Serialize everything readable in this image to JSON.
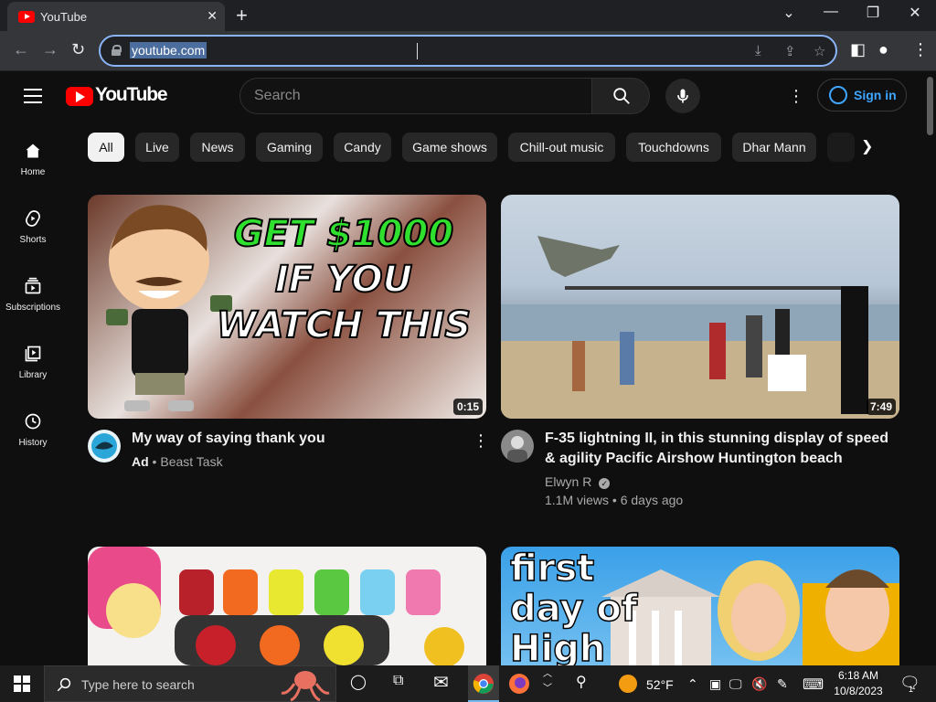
{
  "browser": {
    "tab_title": "YouTube",
    "url": "youtube.com"
  },
  "youtube": {
    "logo_text": "YouTube",
    "search_placeholder": "Search",
    "signin_label": "Sign in",
    "sidebar": [
      {
        "label": "Home",
        "icon": "home-icon"
      },
      {
        "label": "Shorts",
        "icon": "shorts-icon"
      },
      {
        "label": "Subscriptions",
        "icon": "subscriptions-icon"
      },
      {
        "label": "Library",
        "icon": "library-icon"
      },
      {
        "label": "History",
        "icon": "history-icon"
      }
    ],
    "chips": [
      "All",
      "Live",
      "News",
      "Gaming",
      "Candy",
      "Game shows",
      "Chill-out music",
      "Touchdowns",
      "Dhar Mann"
    ],
    "videos": [
      {
        "title": "My way of saying thank you",
        "ad_label": "Ad",
        "channel": "Beast Task",
        "duration": "0:15",
        "thumb_text": [
          "GET $1000",
          "IF YOU",
          "WATCH THIS"
        ]
      },
      {
        "title_line1": "F-35 lightning II, in this stunning display of speed",
        "title_line2": "& agility Pacific Airshow Huntington beach",
        "channel": "Elwyn R",
        "stats": "1.1M views • 6 days ago",
        "duration": "7:49"
      },
      {
        "title": "",
        "thumb_text": []
      },
      {
        "thumb_text": [
          "first",
          "day of",
          "High"
        ]
      }
    ]
  },
  "taskbar": {
    "search_placeholder": "Type here to search",
    "weather": "52°F",
    "time": "6:18 AM",
    "date": "10/8/2023",
    "notification_count": "1"
  },
  "colors": {
    "yt_red": "#ff0000",
    "signin_blue": "#3ea6ff",
    "background": "#0f0f0f"
  }
}
